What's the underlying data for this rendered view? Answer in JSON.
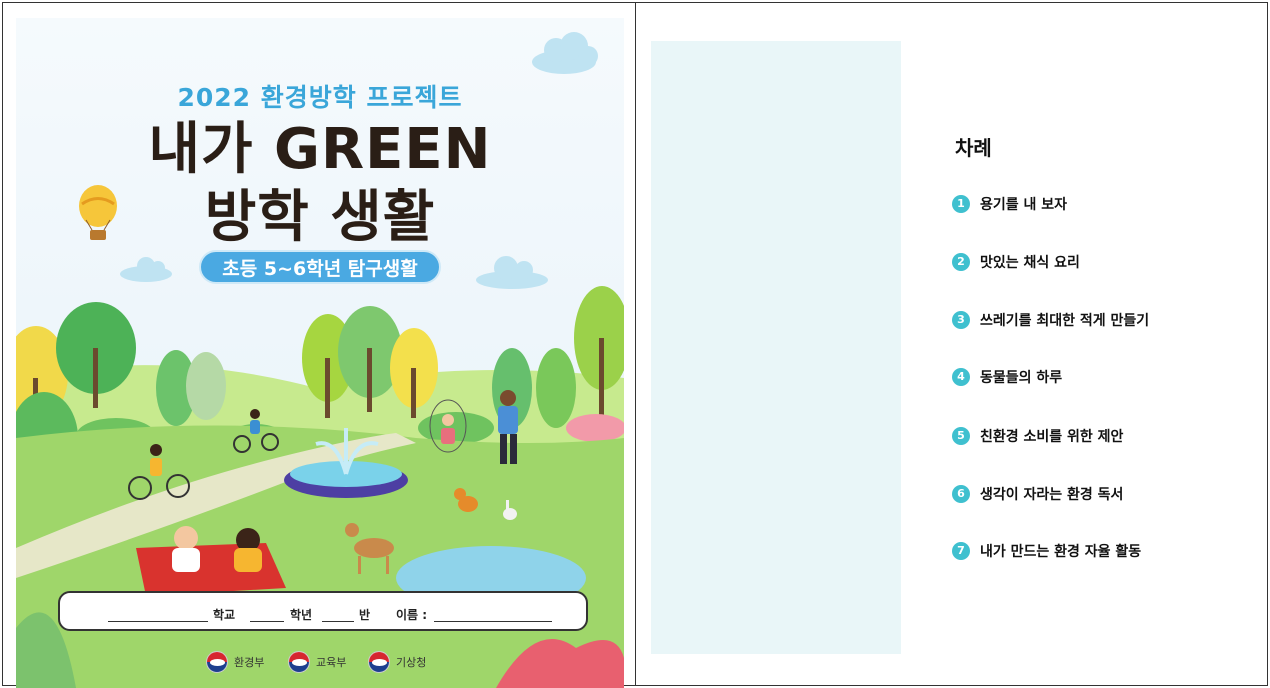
{
  "cover": {
    "project_title": "2022 환경방학 프로젝트",
    "main_title_line1": "내가 GREEN",
    "main_title_line2": "방학 생활",
    "grade_label": "초등 5~6학년 탐구생활",
    "name_fields": {
      "school": "학교",
      "grade": "학년",
      "class": "반",
      "name": "이름 :"
    },
    "ministries": [
      "환경부",
      "교육부",
      "기상청"
    ],
    "colors": {
      "title_blue": "#3aa6d9",
      "title_dark": "#2a1e16",
      "pill": "#4aa9e2",
      "grass": "#9fd66a"
    }
  },
  "toc": {
    "heading": "차례",
    "items": [
      {
        "number": "1",
        "label": "용기를 내 보자"
      },
      {
        "number": "2",
        "label": "맛있는 채식 요리"
      },
      {
        "number": "3",
        "label": "쓰레기를 최대한 적게 만들기"
      },
      {
        "number": "4",
        "label": "동물들의 하루"
      },
      {
        "number": "5",
        "label": "친환경 소비를 위한 제안"
      },
      {
        "number": "6",
        "label": "생각이 자라는 환경 독서"
      },
      {
        "number": "7",
        "label": "내가 만드는 환경 자율 활동"
      }
    ],
    "colors": {
      "band": "#e9f6f8",
      "number_badge": "#3fc0cf"
    }
  }
}
